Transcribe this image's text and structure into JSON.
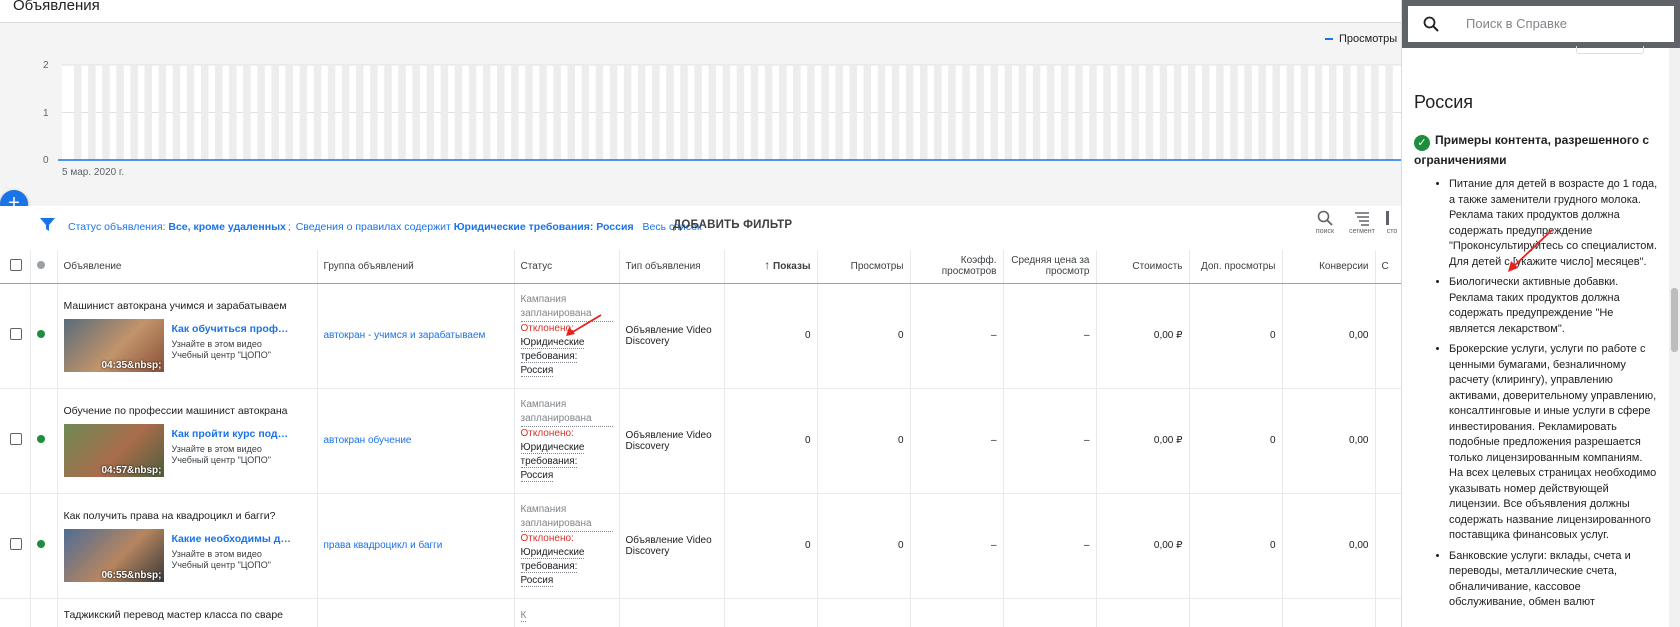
{
  "page_title": "Объявления",
  "chart": {
    "legend": "Просмотры",
    "y_ticks": [
      "2",
      "1",
      "0"
    ],
    "x_start_label": "5 мар. 2020 г."
  },
  "chart_data": {
    "type": "line",
    "series": [
      {
        "name": "Просмотры",
        "values": [
          0
        ]
      }
    ],
    "ylim": [
      0,
      2
    ],
    "x_first_label": "5 мар. 2020 г."
  },
  "fab": {
    "label": "+"
  },
  "filter": {
    "status_prefix": "Статус объявления:",
    "status_value": "Все, кроме удаленных",
    "rules_prefix": "Сведения о правилах содержит",
    "rules_value": "Юридические требования: Россия",
    "full_list": "Весь список",
    "add_filter": "ДОБАВИТЬ ФИЛЬТР",
    "tools": [
      {
        "label": "поиск",
        "icon": "search-icon"
      },
      {
        "label": "сегмент",
        "icon": "segment-icon"
      },
      {
        "label": "сто",
        "icon": "columns-icon"
      }
    ]
  },
  "table": {
    "columns": [
      "Объявление",
      "Группа объявлений",
      "Статус",
      "Тип объявления",
      "Показы",
      "Просмотры",
      "Коэфф. просмотров",
      "Средняя цена за просмотр",
      "Стоимость",
      "Доп. просмотры",
      "Конверсии",
      "С"
    ],
    "sort_column": "Показы",
    "rows": [
      {
        "title": "Машинист автокрана учимся и зарабатываем",
        "link": "Как обучиться профессии",
        "sub1": "Узнайте в этом видео",
        "sub2": "Учебный центр \"ЦОПО\"",
        "duration": "04:35&nbsp;",
        "group": "автокран - учимся и зарабатываем",
        "status_campaign": "Кампания запланирована",
        "status_rejected": "Отклонено:",
        "status_reason": "Юридические требования: Россия",
        "ad_type": "Объявление Video Discovery",
        "impressions": "0",
        "views": "0",
        "view_rate": "–",
        "avg_cpv": "–",
        "cost": "0,00 ₽",
        "extra_views": "0",
        "conversions": "0,00"
      },
      {
        "title": "Обучение по профессии машинист автокрана",
        "link": "Как пройти курс подготовки",
        "sub1": "Узнайте в этом видео",
        "sub2": "Учебный центр \"ЦОПО\"",
        "duration": "04:57&nbsp;",
        "group": "автокран обучение",
        "status_campaign": "Кампания запланирована",
        "status_rejected": "Отклонено:",
        "status_reason": "Юридические требования: Россия",
        "ad_type": "Объявление Video Discovery",
        "impressions": "0",
        "views": "0",
        "view_rate": "–",
        "avg_cpv": "–",
        "cost": "0,00 ₽",
        "extra_views": "0",
        "conversions": "0,00"
      },
      {
        "title": "Как получить права на квадроцикл и багги?",
        "link": "Какие необходимы документы",
        "sub1": "Узнайте в этом видео",
        "sub2": "Учебный центр \"ЦОПО\"",
        "duration": "06:55&nbsp;",
        "group": "права квадроцикл и багги",
        "status_campaign": "Кампания запланирована",
        "status_rejected": "Отклонено:",
        "status_reason": "Юридические требования: Россия",
        "ad_type": "Объявление Video Discovery",
        "impressions": "0",
        "views": "0",
        "view_rate": "–",
        "avg_cpv": "–",
        "cost": "0,00 ₽",
        "extra_views": "0",
        "conversions": "0,00"
      }
    ],
    "partial_row_title": "Таджикский перевод мастер класса по сваре",
    "partial_row_status": "К"
  },
  "help": {
    "search_placeholder": "Поиск в Справке",
    "heading": "Россия",
    "subheading": "Примеры контента, разрешенного с ограничениями",
    "items": [
      "Питание для детей в возрасте до 1 года, а также заменители грудного молока. Реклама таких продуктов должна содержать предупреждение \"Проконсультируйтесь со специалистом. Для детей с [укажите число] месяцев\".",
      "Биологически активные добавки. Реклама таких продуктов должна содержать предупреждение \"Не является лекарством\".",
      "Брокерские услуги, услуги по работе с ценными бумагами, безналичному расчету (клирингу), управлению активами, доверительному управлению, консалтинговые и иные услуги в сфере инвестирования. Рекламировать подобные предложения разрешается только лицензированным компаниям. На всех целевых страницах необходимо указывать номер действующей лицензии. Все объявления должны содержать название лицензированного поставщика финансовых услуг.",
      "Банковские услуги: вклады, счета и переводы, металлические счета, обналичивание, кассовое обслуживание, обмен валют"
    ]
  },
  "colors": {
    "accent": "#1a73e8",
    "status_ok": "#1e8e3e",
    "rejected": "#d93025",
    "annotation": "#e8211d"
  }
}
